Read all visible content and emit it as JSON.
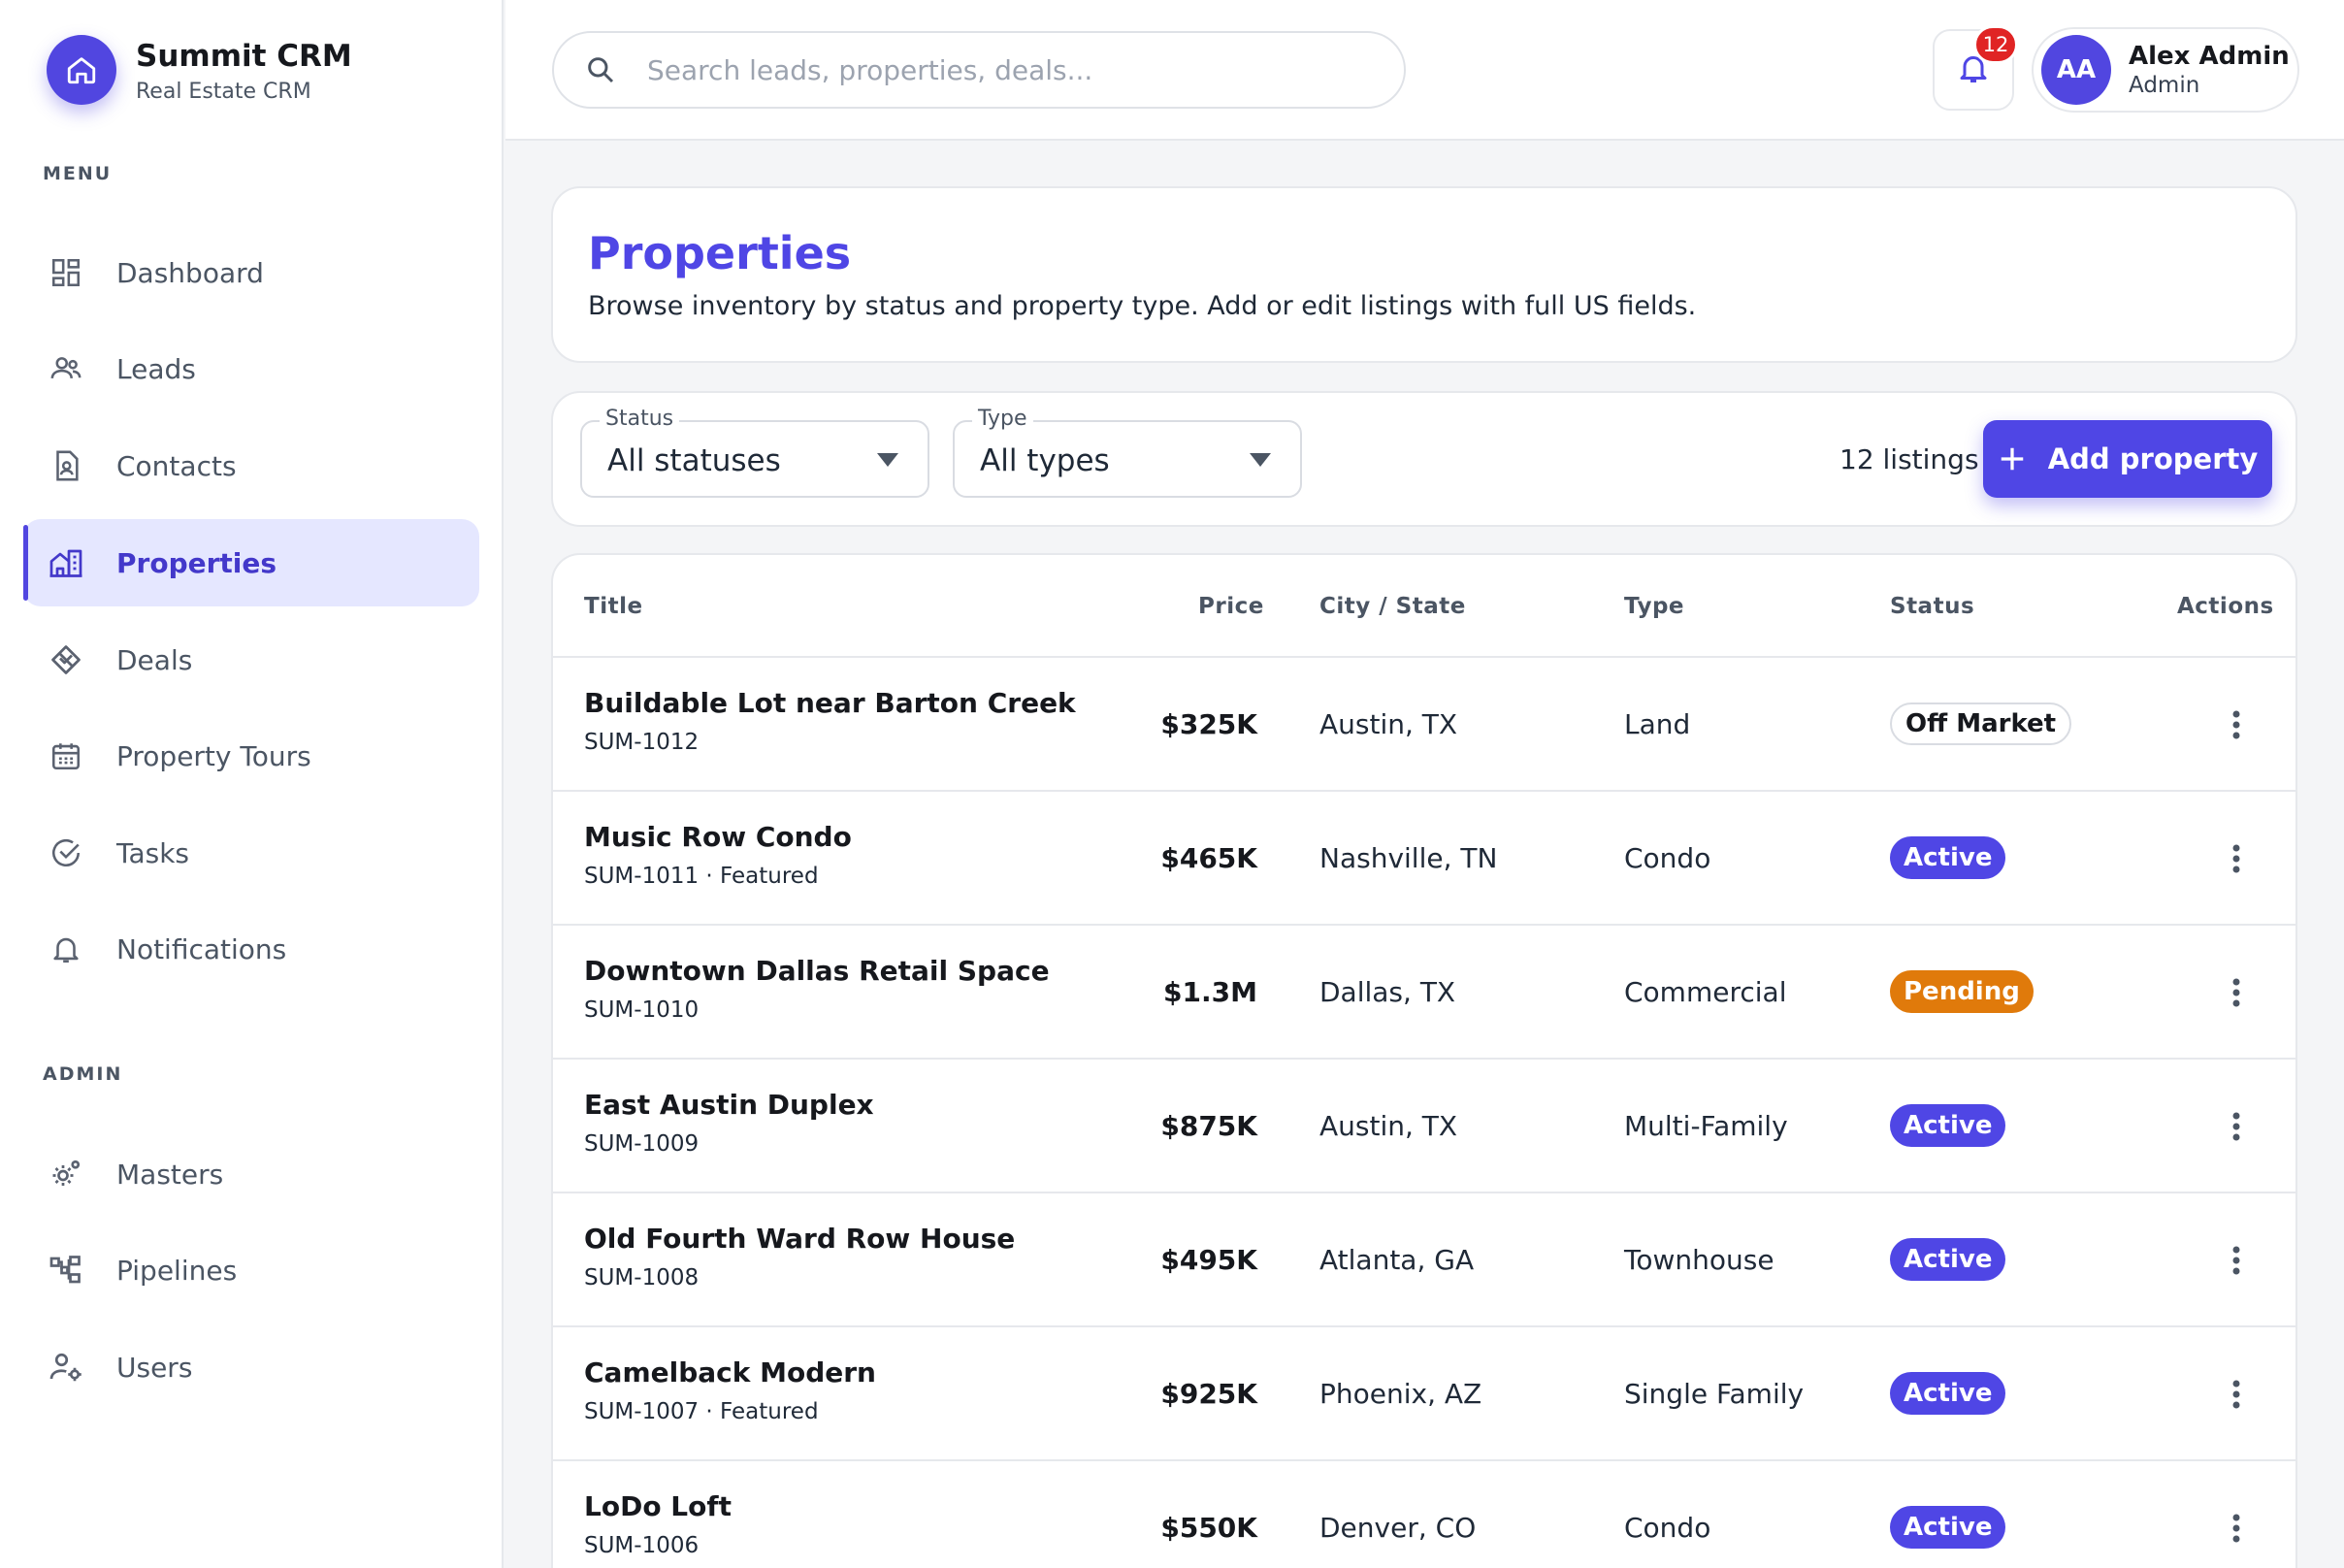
{
  "brand": {
    "name": "Summit CRM",
    "subtitle": "Real Estate CRM",
    "logo_icon": "home-icon"
  },
  "sidebar": {
    "menu_label": "MENU",
    "admin_label": "ADMIN",
    "menu_items": [
      {
        "label": "Dashboard",
        "icon": "dashboard-icon"
      },
      {
        "label": "Leads",
        "icon": "people-icon"
      },
      {
        "label": "Contacts",
        "icon": "contact-card-icon"
      },
      {
        "label": "Properties",
        "icon": "buildings-icon",
        "active": true
      },
      {
        "label": "Deals",
        "icon": "handshake-icon"
      },
      {
        "label": "Property Tours",
        "icon": "calendar-icon"
      },
      {
        "label": "Tasks",
        "icon": "check-circle-icon"
      },
      {
        "label": "Notifications",
        "icon": "bell-icon"
      }
    ],
    "admin_items": [
      {
        "label": "Masters",
        "icon": "gears-icon"
      },
      {
        "label": "Pipelines",
        "icon": "pipeline-icon"
      },
      {
        "label": "Users",
        "icon": "user-settings-icon"
      }
    ],
    "accent": "#5146e0"
  },
  "topbar": {
    "search_placeholder": "Search leads, properties, deals...",
    "notification_count": "12",
    "user": {
      "initials": "AA",
      "name": "Alex Admin",
      "role": "Admin"
    }
  },
  "page": {
    "title": "Properties",
    "description": "Browse inventory by status and property type. Add or edit listings with full US fields."
  },
  "filters": {
    "status": {
      "label": "Status",
      "value": "All statuses"
    },
    "type": {
      "label": "Type",
      "value": "All types"
    },
    "count": "12 listings",
    "add_button": "Add property"
  },
  "table": {
    "headers": [
      "Title",
      "Price",
      "City / State",
      "Type",
      "Status",
      "Actions"
    ],
    "rows": [
      {
        "title": "Buildable Lot near Barton Creek",
        "sub": "SUM-1012",
        "price": "$325K",
        "city": "Austin, TX",
        "type": "Land",
        "status": "Off Market",
        "status_kind": "off"
      },
      {
        "title": "Music Row Condo",
        "sub": "SUM-1011 · Featured",
        "price": "$465K",
        "city": "Nashville, TN",
        "type": "Condo",
        "status": "Active",
        "status_kind": "active"
      },
      {
        "title": "Downtown Dallas Retail Space",
        "sub": "SUM-1010",
        "price": "$1.3M",
        "city": "Dallas, TX",
        "type": "Commercial",
        "status": "Pending",
        "status_kind": "pending"
      },
      {
        "title": "East Austin Duplex",
        "sub": "SUM-1009",
        "price": "$875K",
        "city": "Austin, TX",
        "type": "Multi-Family",
        "status": "Active",
        "status_kind": "active"
      },
      {
        "title": "Old Fourth Ward Row House",
        "sub": "SUM-1008",
        "price": "$495K",
        "city": "Atlanta, GA",
        "type": "Townhouse",
        "status": "Active",
        "status_kind": "active"
      },
      {
        "title": "Camelback Modern",
        "sub": "SUM-1007 · Featured",
        "price": "$925K",
        "city": "Phoenix, AZ",
        "type": "Single Family",
        "status": "Active",
        "status_kind": "active"
      },
      {
        "title": "LoDo Loft",
        "sub": "SUM-1006",
        "price": "$550K",
        "city": "Denver, CO",
        "type": "Condo",
        "status": "Active",
        "status_kind": "active"
      }
    ]
  },
  "colors": {
    "primary": "#4f46e5",
    "pending": "#e07a0b",
    "badge_red": "#e02424"
  }
}
